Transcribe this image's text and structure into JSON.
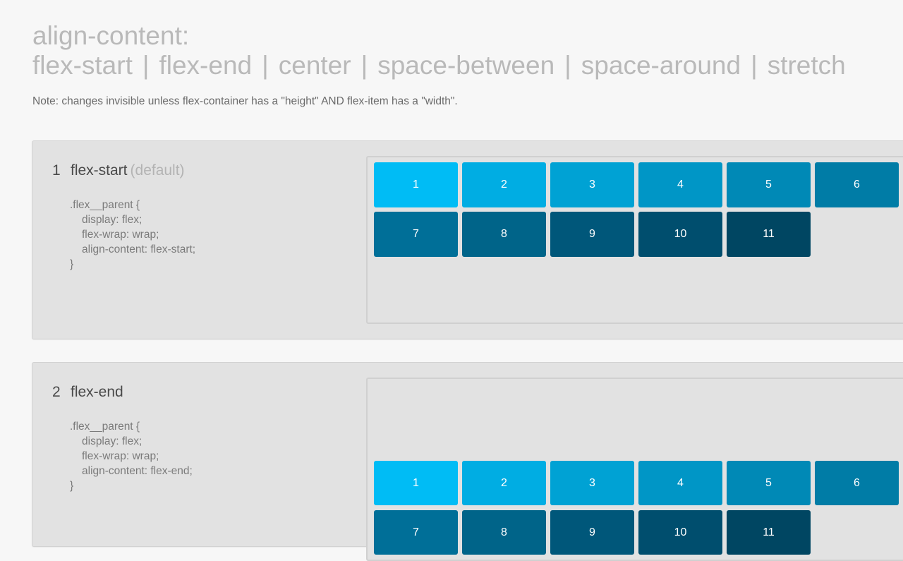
{
  "header": {
    "title_line1": "align-content:",
    "title_options": [
      "flex-start",
      "flex-end",
      "center",
      "space-between",
      "space-around",
      "stretch"
    ],
    "separator": "|",
    "note": "Note: changes invisible unless flex-container has a \"height\" AND flex-item has a \"width\"."
  },
  "panels": [
    {
      "number": "1",
      "name": "flex-start",
      "default_label": "(default)",
      "code": [
        ".flex__parent {",
        "display: flex;",
        "flex-wrap: wrap;",
        "align-content: flex-start;",
        "}"
      ],
      "items": [
        "1",
        "2",
        "3",
        "4",
        "5",
        "6",
        "7",
        "8",
        "9",
        "10",
        "11"
      ]
    },
    {
      "number": "2",
      "name": "flex-end",
      "code": [
        ".flex__parent {",
        "display: flex;",
        "flex-wrap: wrap;",
        "align-content: flex-end;",
        "}"
      ],
      "items": [
        "1",
        "2",
        "3",
        "4",
        "5",
        "6",
        "7",
        "8",
        "9",
        "10",
        "11"
      ]
    }
  ],
  "colors": {
    "page_background": "#f7f7f7",
    "panel_background": "#e2e2e2",
    "title": "#b9b9b9",
    "item_gradient": [
      "#00bcf5",
      "#00ade3",
      "#00a2d4",
      "#0096c6",
      "#0089b6",
      "#007ca6",
      "#006f98",
      "#006489",
      "#00577a",
      "#004e6e",
      "#004662"
    ]
  }
}
